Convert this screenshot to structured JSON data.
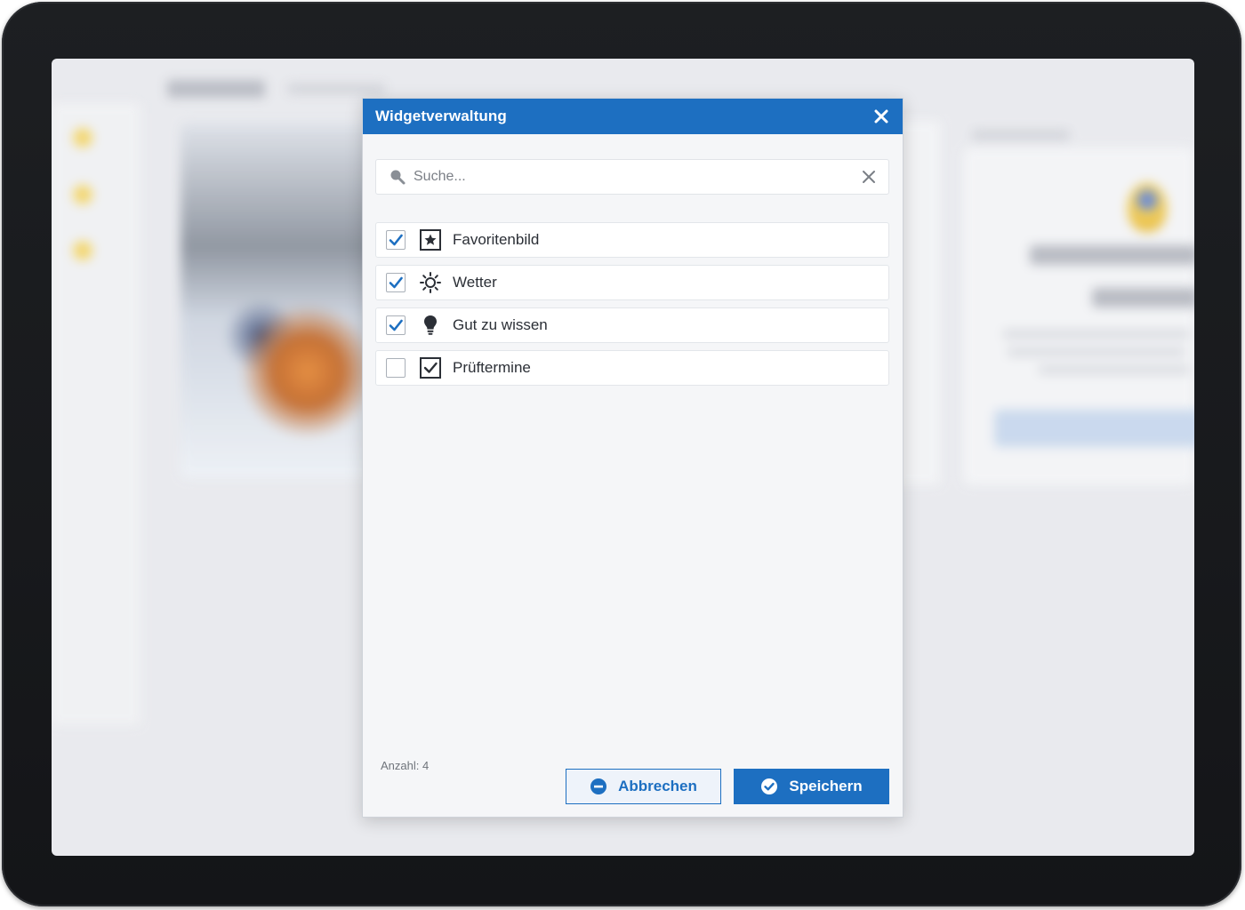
{
  "dialog": {
    "title": "Widgetverwaltung",
    "close_icon": "close-icon",
    "search": {
      "placeholder": "Suche...",
      "value": "",
      "search_icon": "search-icon",
      "clear_icon": "clear-icon"
    },
    "widgets": [
      {
        "label": "Favoritenbild",
        "icon": "star-frame-icon",
        "checked": true
      },
      {
        "label": "Wetter",
        "icon": "sun-icon",
        "checked": true
      },
      {
        "label": "Gut zu wissen",
        "icon": "lightbulb-icon",
        "checked": true
      },
      {
        "label": "Prüftermine",
        "icon": "checkbox-frame-icon",
        "checked": false
      }
    ],
    "count_label": "Anzahl: 4",
    "buttons": {
      "cancel_label": "Abbrechen",
      "save_label": "Speichern"
    }
  },
  "colors": {
    "accent": "#1d6fc1",
    "dialog_bg": "#f5f6f8",
    "frame": "#1a1b1e"
  }
}
